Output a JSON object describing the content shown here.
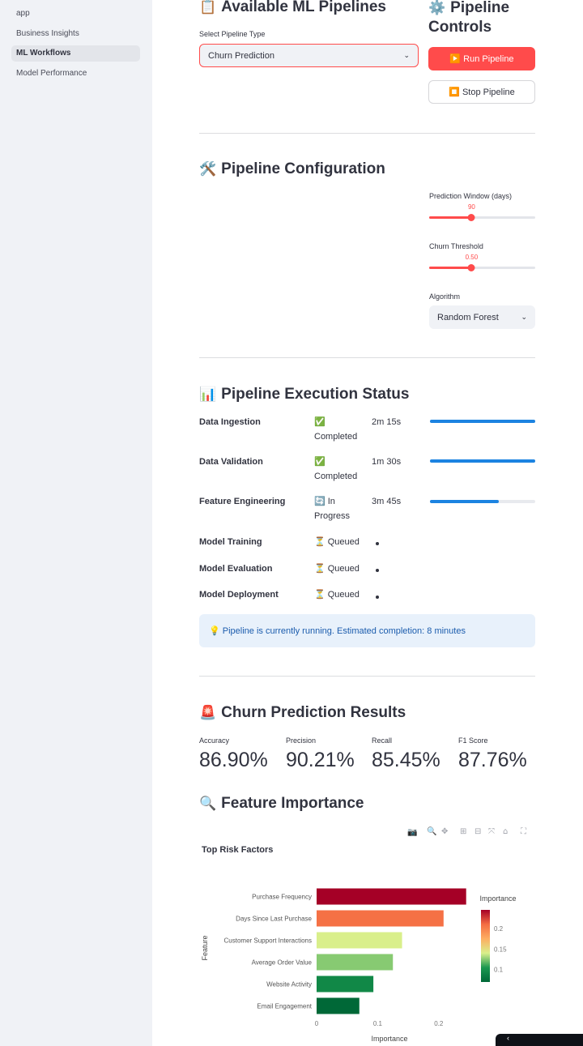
{
  "sidebar": {
    "items": [
      {
        "label": "app"
      },
      {
        "label": "Business Insights"
      },
      {
        "label": "ML Workflows"
      },
      {
        "label": "Model Performance"
      }
    ]
  },
  "pipelines": {
    "title": "Available ML Pipelines",
    "title_emoji": "📋",
    "select_label": "Select Pipeline Type",
    "select_value": "Churn Prediction"
  },
  "controls": {
    "title": "Pipeline Controls",
    "title_emoji": "⚙️",
    "run_label": "▶️ Run Pipeline",
    "stop_label": "⏹️ Stop Pipeline"
  },
  "config": {
    "title": "Pipeline Configuration",
    "title_emoji": "🛠️",
    "window_label": "Prediction Window (days)",
    "window_value": "90",
    "window_fraction": 0.4,
    "threshold_label": "Churn Threshold",
    "threshold_value": "0.50",
    "threshold_fraction": 0.4,
    "algorithm_label": "Algorithm",
    "algorithm_value": "Random Forest"
  },
  "status": {
    "title": "Pipeline Execution Status",
    "title_emoji": "📊",
    "stages": [
      {
        "name": "Data Ingestion",
        "status": "✅ Completed",
        "time": "2m 15s",
        "progress": 1.0
      },
      {
        "name": "Data Validation",
        "status": "✅ Completed",
        "time": "1m 30s",
        "progress": 1.0
      },
      {
        "name": "Feature Engineering",
        "status": "🔄 In Progress",
        "time": "3m 45s",
        "progress": 0.65
      },
      {
        "name": "Model Training",
        "status": "⏳ Queued",
        "time": ""
      },
      {
        "name": "Model Evaluation",
        "status": "⏳ Queued",
        "time": ""
      },
      {
        "name": "Model Deployment",
        "status": "⏳ Queued",
        "time": ""
      }
    ],
    "info": "💡 Pipeline is currently running. Estimated completion: 8 minutes"
  },
  "results": {
    "title": "Churn Prediction Results",
    "title_emoji": "🚨",
    "metrics": [
      {
        "label": "Accuracy",
        "value": "86.90%"
      },
      {
        "label": "Precision",
        "value": "90.21%"
      },
      {
        "label": "Recall",
        "value": "85.45%"
      },
      {
        "label": "F1 Score",
        "value": "87.76%"
      }
    ]
  },
  "importance": {
    "title": "Feature Importance",
    "title_emoji": "🔍"
  },
  "toolbar_icons": [
    "camera-icon",
    "zoom-icon",
    "pan-icon",
    "zoom-in-icon",
    "zoom-out-icon",
    "autoscale-icon",
    "reset-axes-icon",
    "fullscreen-icon"
  ],
  "chart_data": {
    "type": "bar",
    "orientation": "horizontal",
    "title": "Top Risk Factors",
    "xlabel": "Importance",
    "ylabel": "Feature",
    "categories": [
      "Purchase Frequency",
      "Days Since Last Purchase",
      "Customer Support Interactions",
      "Average Order Value",
      "Website Activity",
      "Email Engagement"
    ],
    "values": [
      0.245,
      0.208,
      0.14,
      0.125,
      0.093,
      0.07
    ],
    "xlim": [
      0,
      0.26
    ],
    "xticks": [
      "0",
      "0.1",
      "0.2"
    ],
    "colorbar": {
      "title": "Importance",
      "ticks": [
        "0.2",
        "0.15",
        "0.1"
      ],
      "range": [
        0.07,
        0.245
      ],
      "colors": [
        "#006837",
        "#1a9850",
        "#d9ef8b",
        "#fdae61",
        "#f46d43",
        "#a50026"
      ]
    },
    "grid": false
  }
}
